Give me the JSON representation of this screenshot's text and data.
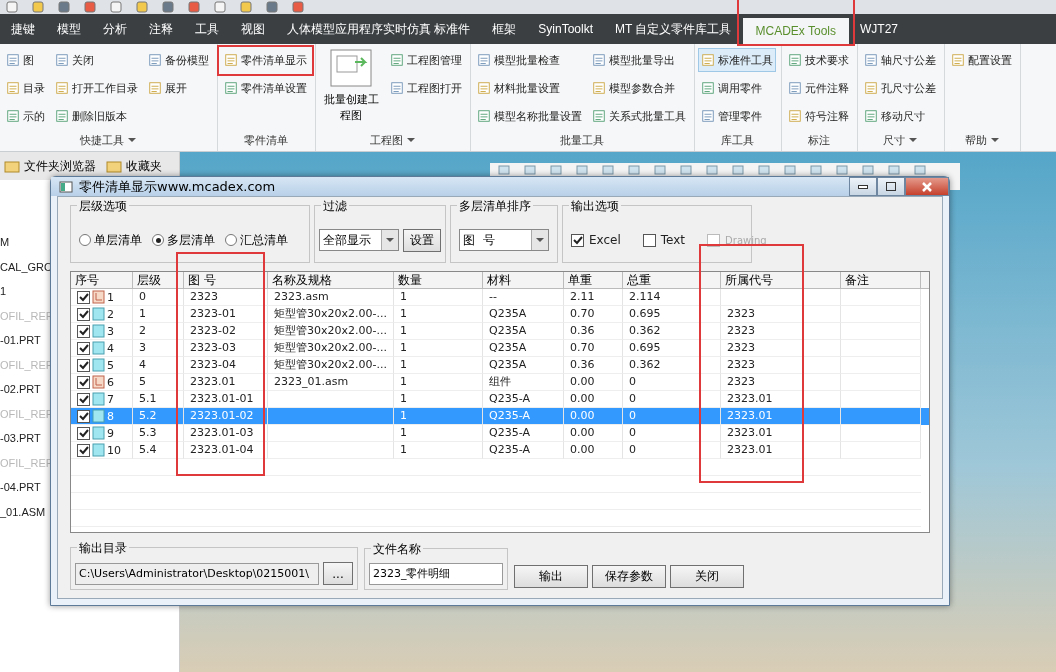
{
  "menu_tabs": [
    {
      "label": "捷键",
      "selected": false,
      "marked": false
    },
    {
      "label": "模型",
      "selected": false,
      "marked": false
    },
    {
      "label": "分析",
      "selected": false,
      "marked": false
    },
    {
      "label": "注释",
      "selected": false,
      "marked": false
    },
    {
      "label": "工具",
      "selected": false,
      "marked": false
    },
    {
      "label": "视图",
      "selected": false,
      "marked": false
    },
    {
      "label": "人体模型应用程序实时仿真 标准件",
      "selected": false,
      "marked": false
    },
    {
      "label": "框架",
      "selected": false,
      "marked": false
    },
    {
      "label": "SyinToolkt",
      "selected": false,
      "marked": false
    },
    {
      "label": "MT 自定义零件库工具",
      "selected": false,
      "marked": false
    },
    {
      "label": "MCADEx Tools",
      "selected": true,
      "marked": true
    },
    {
      "label": "WJT27",
      "selected": false,
      "marked": false
    }
  ],
  "ribbon_groups": [
    {
      "label": "快捷工具",
      "has_menu": true,
      "columns": [
        [
          {
            "label": "图"
          },
          {
            "label": "目录"
          },
          {
            "label": "示的"
          }
        ],
        [
          {
            "label": "关闭"
          },
          {
            "label": "打开工作目录"
          },
          {
            "label": "删除旧版本"
          }
        ],
        [
          {
            "label": "备份模型"
          },
          {
            "label": "展开"
          }
        ]
      ]
    },
    {
      "label": "零件清单",
      "has_menu": false,
      "columns": [
        [
          {
            "label": "零件清单显示",
            "marked": true
          },
          {
            "label": "零件清单设置",
            "marked": false
          }
        ]
      ]
    },
    {
      "label": "工程图",
      "has_menu": true,
      "large": "批量创建工程图",
      "columns": [
        [
          {
            "label": "工程图管理"
          },
          {
            "label": "工程图打开"
          }
        ]
      ]
    },
    {
      "label": "批量工具",
      "has_menu": false,
      "columns": [
        [
          {
            "label": "模型批量检查"
          },
          {
            "label": "材料批量设置"
          },
          {
            "label": "模型名称批量设置"
          }
        ],
        [
          {
            "label": "模型批量导出"
          },
          {
            "label": "模型参数合并"
          },
          {
            "label": "关系式批量工具"
          }
        ]
      ]
    },
    {
      "label": "库工具",
      "has_menu": false,
      "columns": [
        [
          {
            "label": "标准件工具",
            "active": true
          },
          {
            "label": "调用零件",
            "active": false
          },
          {
            "label": "管理零件",
            "active": false
          }
        ]
      ]
    },
    {
      "label": "标注",
      "has_menu": false,
      "columns": [
        [
          {
            "label": "技术要求"
          },
          {
            "label": "元件注释"
          },
          {
            "label": "符号注释"
          }
        ]
      ]
    },
    {
      "label": "尺寸",
      "has_menu": true,
      "columns": [
        [
          {
            "label": "轴尺寸公差"
          },
          {
            "label": "孔尺寸公差"
          },
          {
            "label": "移动尺寸"
          }
        ]
      ]
    },
    {
      "label": "帮助",
      "has_menu": true,
      "columns": [
        [
          {
            "label": "配置设置"
          }
        ]
      ]
    }
  ],
  "side_tabs": [
    "文件夹浏览器",
    "收藏夹"
  ],
  "tree_items": [
    {
      "label": "M",
      "dimmed": false
    },
    {
      "label": "CAL_GRO",
      "dimmed": false
    },
    {
      "label": "1",
      "dimmed": false
    },
    {
      "label": "OFIL_REF",
      "dimmed": true
    },
    {
      "label": "-01.PRT",
      "dimmed": false
    },
    {
      "label": "OFIL_REF",
      "dimmed": true
    },
    {
      "label": "-02.PRT",
      "dimmed": false
    },
    {
      "label": "OFIL_REF",
      "dimmed": true
    },
    {
      "label": "-03.PRT",
      "dimmed": false
    },
    {
      "label": "OFIL_REF",
      "dimmed": true
    },
    {
      "label": "-04.PRT",
      "dimmed": false
    },
    {
      "label": "_01.ASM",
      "dimmed": false
    }
  ],
  "dialog": {
    "title": "零件清单显示www.mcadex.com",
    "level_options": {
      "title": "层级选项",
      "options": [
        {
          "label": "单层清单",
          "selected": false
        },
        {
          "label": "多层清单",
          "selected": true
        },
        {
          "label": "汇总清单",
          "selected": false
        }
      ]
    },
    "filter": {
      "title": "过滤",
      "value": "全部显示",
      "button": "设置"
    },
    "sort": {
      "title": "多层清单排序",
      "value": "图  号"
    },
    "output_options": {
      "title": "输出选项",
      "options": [
        {
          "label": "Excel",
          "checked": true,
          "disabled": false
        },
        {
          "label": "Text",
          "checked": false,
          "disabled": false
        },
        {
          "label": "Drawing",
          "checked": false,
          "disabled": true
        }
      ]
    },
    "table": {
      "columns": [
        {
          "label": "序号",
          "marked": false
        },
        {
          "label": "层级",
          "marked": false
        },
        {
          "label": "图  号",
          "marked": true
        },
        {
          "label": "名称及规格",
          "marked": false
        },
        {
          "label": "数量",
          "marked": false
        },
        {
          "label": "材料",
          "marked": false
        },
        {
          "label": "单重",
          "marked": false
        },
        {
          "label": "总重",
          "marked": false
        },
        {
          "label": "所属代号",
          "marked": true
        },
        {
          "label": "备注",
          "marked": false
        }
      ],
      "rows": [
        {
          "kind": "assembly",
          "checked": true,
          "selected": false,
          "cells": [
            "1",
            "0",
            "2323",
            "2323.asm",
            "1",
            "--",
            "2.11",
            "2.114",
            null,
            null
          ]
        },
        {
          "kind": "part",
          "checked": true,
          "selected": false,
          "cells": [
            "2",
            "1",
            "2323-01",
            "矩型管30x20x2.00-...",
            "1",
            "Q235A",
            "0.70",
            "0.695",
            "2323",
            null
          ]
        },
        {
          "kind": "part",
          "checked": true,
          "selected": false,
          "cells": [
            "3",
            "2",
            "2323-02",
            "矩型管30x20x2.00-...",
            "1",
            "Q235A",
            "0.36",
            "0.362",
            "2323",
            null
          ]
        },
        {
          "kind": "part",
          "checked": true,
          "selected": false,
          "cells": [
            "4",
            "3",
            "2323-03",
            "矩型管30x20x2.00-...",
            "1",
            "Q235A",
            "0.70",
            "0.695",
            "2323",
            null
          ]
        },
        {
          "kind": "part",
          "checked": true,
          "selected": false,
          "cells": [
            "5",
            "4",
            "2323-04",
            "矩型管30x20x2.00-...",
            "1",
            "Q235A",
            "0.36",
            "0.362",
            "2323",
            null
          ]
        },
        {
          "kind": "assembly",
          "checked": true,
          "selected": false,
          "cells": [
            "6",
            "5",
            "2323.01",
            "2323_01.asm",
            "1",
            "组件",
            "0.00",
            "0",
            "2323",
            null
          ]
        },
        {
          "kind": "part",
          "checked": true,
          "selected": false,
          "cells": [
            "7",
            "5.1",
            "2323.01-01",
            null,
            "1",
            "Q235-A",
            "0.00",
            "0",
            "2323.01",
            null
          ]
        },
        {
          "kind": "part",
          "checked": true,
          "selected": true,
          "cells": [
            "8",
            "5.2",
            "2323.01-02",
            null,
            "1",
            "Q235-A",
            "0.00",
            "0",
            "2323.01",
            null
          ]
        },
        {
          "kind": "part",
          "checked": true,
          "selected": false,
          "cells": [
            "9",
            "5.3",
            "2323.01-03",
            null,
            "1",
            "Q235-A",
            "0.00",
            "0",
            "2323.01",
            null
          ]
        },
        {
          "kind": "part",
          "checked": true,
          "selected": false,
          "cells": [
            "10",
            "5.4",
            "2323.01-04",
            null,
            "1",
            "Q235-A",
            "0.00",
            "0",
            "2323.01",
            null
          ]
        }
      ]
    },
    "output_dir": {
      "title": "输出目录",
      "value": "C:\\Users\\Administrator\\Desktop\\0215001\\",
      "browse_button": "..."
    },
    "file_name": {
      "title": "文件名称",
      "value": "2323_零件明细"
    },
    "buttons": [
      "输出",
      "保存参数",
      "关闭"
    ]
  }
}
